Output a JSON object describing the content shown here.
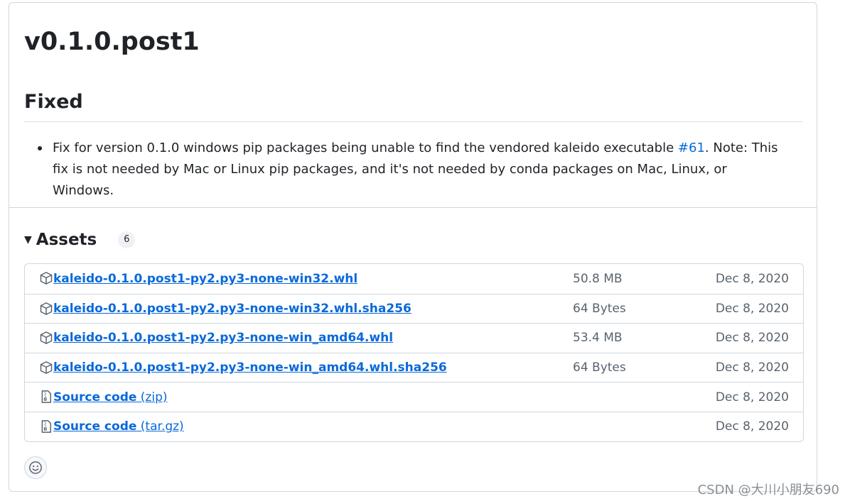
{
  "release": {
    "title": "v0.1.0.post1",
    "section_heading": "Fixed",
    "note_before_link": "Fix for version 0.1.0 windows pip packages being unable to find the vendored kaleido executable ",
    "note_link": "#61",
    "note_after_link": ". Note: This fix is not needed by Mac or Linux pip packages, and it's not needed by conda packages on Mac, Linux, or Windows."
  },
  "assets": {
    "title": "Assets",
    "count": "6",
    "items": [
      {
        "icon": "package-icon",
        "name": "kaleido-0.1.0.post1-py2.py3-none-win32.whl",
        "ext": "",
        "size": "50.8 MB",
        "date": "Dec 8, 2020"
      },
      {
        "icon": "package-icon",
        "name": "kaleido-0.1.0.post1-py2.py3-none-win32.whl.sha256",
        "ext": "",
        "size": "64 Bytes",
        "date": "Dec 8, 2020"
      },
      {
        "icon": "package-icon",
        "name": "kaleido-0.1.0.post1-py2.py3-none-win_amd64.whl",
        "ext": "",
        "size": "53.4 MB",
        "date": "Dec 8, 2020"
      },
      {
        "icon": "package-icon",
        "name": "kaleido-0.1.0.post1-py2.py3-none-win_amd64.whl.sha256",
        "ext": "",
        "size": "64 Bytes",
        "date": "Dec 8, 2020"
      },
      {
        "icon": "file-zip-icon",
        "name": "Source code",
        "ext": " (zip)",
        "size": "",
        "date": "Dec 8, 2020"
      },
      {
        "icon": "file-zip-icon",
        "name": "Source code",
        "ext": " (tar.gz)",
        "size": "",
        "date": "Dec 8, 2020"
      }
    ]
  },
  "reaction": {
    "icon": "smiley-icon"
  },
  "watermark": "CSDN @大川小朋友690",
  "colors": {
    "link": "#0969da",
    "text": "#1f2328",
    "muted": "#59636e",
    "border": "#d0d7de"
  }
}
